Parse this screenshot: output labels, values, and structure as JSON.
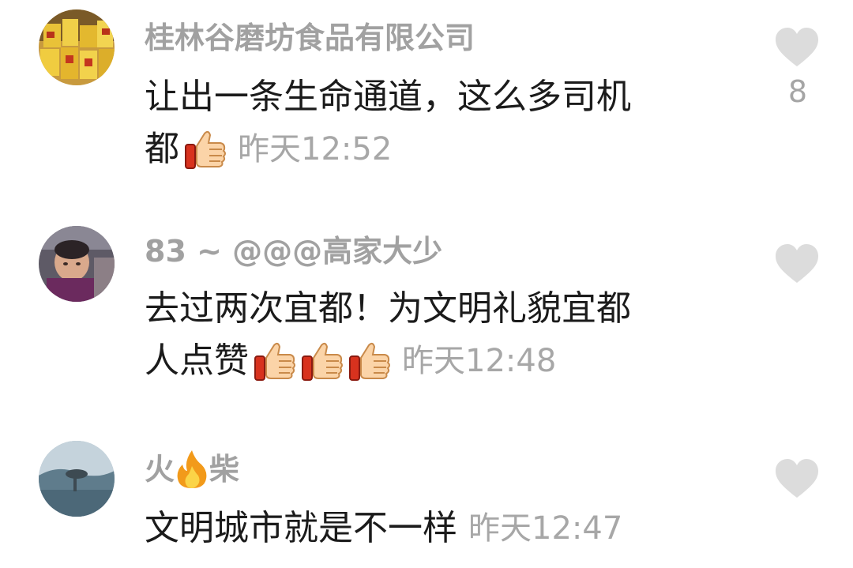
{
  "comments": [
    {
      "username": "桂林谷磨坊食品有限公司",
      "text_line1": "让出一条生命通道，这么多司机",
      "text_line2": "都",
      "emoji": "thumbs-up",
      "timestamp": "昨天12:52",
      "like_count": "8",
      "avatar": "product-boxes-photo"
    },
    {
      "username": "83 ~ @@@高家大少",
      "text_line1": "去过两次宜都！为文明礼貌宜都",
      "text_line2": "人点赞",
      "emoji": "thumbs-up",
      "emoji_count": 3,
      "timestamp": "昨天12:48",
      "like_count": "",
      "avatar": "person-photo"
    },
    {
      "username_part1": "火",
      "username_emoji": "fire",
      "username_part2": "柴",
      "text_line1": "文明城市就是不一样",
      "timestamp": "昨天12:47",
      "like_count": "",
      "avatar": "landscape-photo"
    }
  ],
  "colors": {
    "username": "#a1a1a1",
    "body_text": "#1b1b1b",
    "timestamp": "#a7a7a7",
    "heart_icon": "#dcdcdc",
    "like_count": "#a5a5a5"
  }
}
